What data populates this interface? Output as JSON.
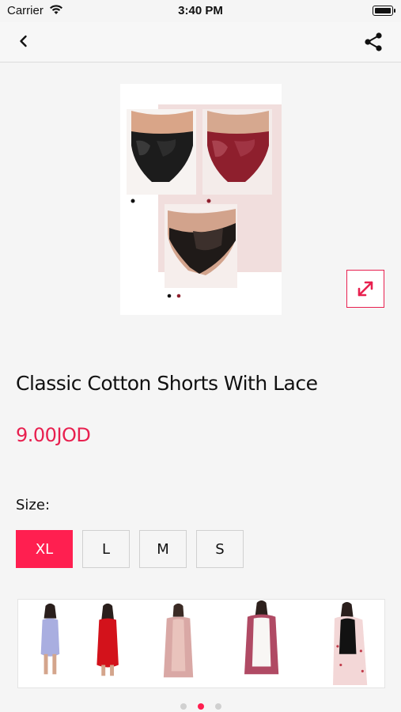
{
  "status_bar": {
    "carrier": "Carrier",
    "time": "3:40 PM"
  },
  "nav": {
    "back_icon": "chevron-left-icon",
    "share_icon": "share-icon"
  },
  "product": {
    "title": "Classic Cotton Shorts With Lace",
    "price": "9.00JOD",
    "size_label": "Size:",
    "sizes": [
      "XL",
      "L",
      "M",
      "S"
    ],
    "selected_size": "XL"
  },
  "carousel": {
    "pages": 3,
    "active_page": 2
  },
  "colors": {
    "accent": "#ff1f50",
    "background": "#f5f5f5"
  }
}
